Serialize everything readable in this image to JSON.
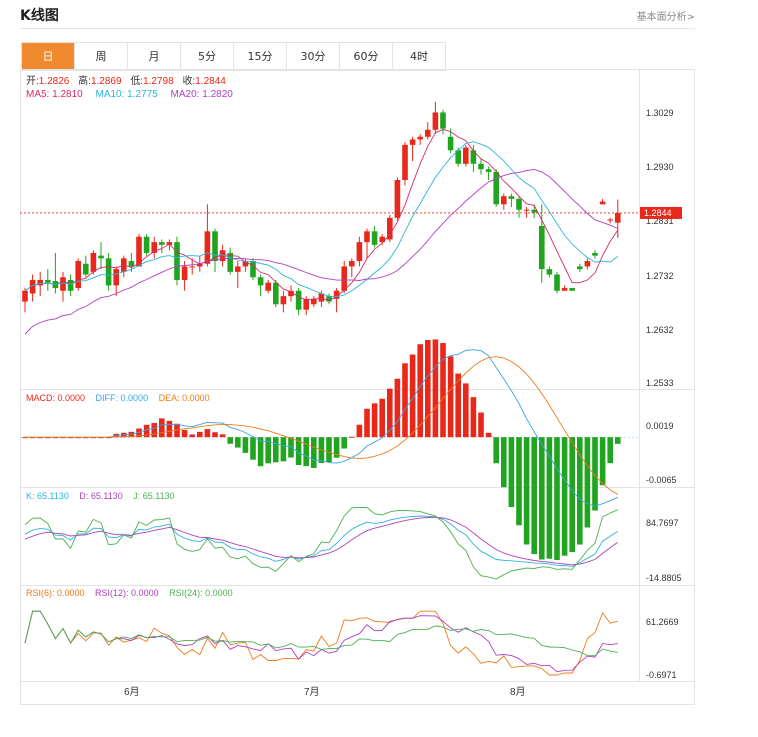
{
  "header": {
    "title": "K线图",
    "link": "基本面分析>"
  },
  "tabs": [
    {
      "label": "日",
      "active": true
    },
    {
      "label": "周",
      "active": false
    },
    {
      "label": "月",
      "active": false
    },
    {
      "label": "5分",
      "active": false
    },
    {
      "label": "15分",
      "active": false
    },
    {
      "label": "30分",
      "active": false
    },
    {
      "label": "60分",
      "active": false
    },
    {
      "label": "4时",
      "active": false
    }
  ],
  "colors": {
    "up": "#e8281a",
    "down": "#1fa51f",
    "ma5": "#d42a6a",
    "ma10": "#2bb5d6",
    "ma20": "#b040c0",
    "diff": "#3ba3e3",
    "dea": "#f07a1a",
    "k": "#2bb5d6",
    "d": "#b040c0",
    "j": "#4caf50",
    "rsi6": "#f07a1a",
    "rsi12": "#b040c0",
    "rsi24": "#4caf50"
  },
  "chart_data": {
    "type": "candlestick",
    "ohlc_info": {
      "open_label": "开:",
      "open": "1.2826",
      "high_label": "高:",
      "high": "1.2869",
      "low_label": "低:",
      "low": "1.2798",
      "close_label": "收:",
      "close": "1.2844"
    },
    "ma_info": {
      "ma5": "MA5: 1.2810",
      "ma10": "MA10: 1.2775",
      "ma20": "MA20: 1.2820"
    },
    "current_price": "1.2844",
    "y_axis": {
      "min": 1.2533,
      "max": 1.308,
      "ticks": [
        "1.3029",
        "1.2930",
        "1.2831",
        "1.2732",
        "1.2632",
        "1.2533"
      ]
    },
    "x_labels": [
      "6月",
      "7月",
      "8月"
    ],
    "candles": [
      [
        1.268,
        1.27,
        1.266,
        1.2705
      ],
      [
        1.2695,
        1.272,
        1.268,
        1.273
      ],
      [
        1.271,
        1.272,
        1.269,
        1.2735
      ],
      [
        1.272,
        1.2715,
        1.27,
        1.274
      ],
      [
        1.2718,
        1.2705,
        1.2695,
        1.277
      ],
      [
        1.27,
        1.2725,
        1.268,
        1.2735
      ],
      [
        1.272,
        1.27,
        1.269,
        1.273
      ],
      [
        1.2705,
        1.2755,
        1.27,
        1.276
      ],
      [
        1.275,
        1.273,
        1.2725,
        1.2765
      ],
      [
        1.2735,
        1.277,
        1.273,
        1.2775
      ],
      [
        1.2765,
        1.276,
        1.274,
        1.279
      ],
      [
        1.276,
        1.271,
        1.27,
        1.277
      ],
      [
        1.271,
        1.274,
        1.269,
        1.2745
      ],
      [
        1.2735,
        1.276,
        1.2725,
        1.2765
      ],
      [
        1.2755,
        1.2745,
        1.2735,
        1.277
      ],
      [
        1.2745,
        1.28,
        1.2745,
        1.2805
      ],
      [
        1.28,
        1.277,
        1.2765,
        1.2805
      ],
      [
        1.277,
        1.279,
        1.276,
        1.28
      ],
      [
        1.279,
        1.2785,
        1.277,
        1.2795
      ],
      [
        1.2785,
        1.279,
        1.2775,
        1.2795
      ],
      [
        1.279,
        1.272,
        1.271,
        1.28
      ],
      [
        1.272,
        1.2745,
        1.27,
        1.2755
      ],
      [
        1.2745,
        1.2745,
        1.273,
        1.276
      ],
      [
        1.2745,
        1.275,
        1.2735,
        1.2765
      ],
      [
        1.275,
        1.281,
        1.2745,
        1.286
      ],
      [
        1.281,
        1.2755,
        1.2735,
        1.2815
      ],
      [
        1.2755,
        1.2775,
        1.2745,
        1.2785
      ],
      [
        1.277,
        1.2735,
        1.273,
        1.278
      ],
      [
        1.2735,
        1.2745,
        1.2705,
        1.2755
      ],
      [
        1.2745,
        1.2755,
        1.2735,
        1.276
      ],
      [
        1.2755,
        1.2725,
        1.272,
        1.276
      ],
      [
        1.2725,
        1.271,
        1.269,
        1.273
      ],
      [
        1.27,
        1.2715,
        1.2695,
        1.272
      ],
      [
        1.2715,
        1.2675,
        1.267,
        1.272
      ],
      [
        1.2675,
        1.269,
        1.266,
        1.27
      ],
      [
        1.269,
        1.27,
        1.268,
        1.271
      ],
      [
        1.27,
        1.2665,
        1.2655,
        1.2705
      ],
      [
        1.2665,
        1.2685,
        1.2655,
        1.269
      ],
      [
        1.2675,
        1.2685,
        1.267,
        1.269
      ],
      [
        1.268,
        1.2695,
        1.267,
        1.27
      ],
      [
        1.269,
        1.268,
        1.2675,
        1.2695
      ],
      [
        1.2685,
        1.27,
        1.266,
        1.2705
      ],
      [
        1.27,
        1.2745,
        1.2695,
        1.2755
      ],
      [
        1.2745,
        1.2755,
        1.2725,
        1.276
      ],
      [
        1.2755,
        1.279,
        1.2745,
        1.28
      ],
      [
        1.279,
        1.281,
        1.276,
        1.2815
      ],
      [
        1.281,
        1.2785,
        1.278,
        1.282
      ],
      [
        1.279,
        1.28,
        1.2785,
        1.2805
      ],
      [
        1.2795,
        1.2835,
        1.279,
        1.284
      ],
      [
        1.2835,
        1.2905,
        1.283,
        1.291
      ],
      [
        1.2905,
        1.297,
        1.2895,
        1.2975
      ],
      [
        1.297,
        1.298,
        1.294,
        1.2985
      ],
      [
        1.298,
        1.2985,
        1.297,
        1.299
      ],
      [
        1.2985,
        1.2998,
        1.298,
        1.3012
      ],
      [
        1.2998,
        1.303,
        1.299,
        1.305
      ],
      [
        1.303,
        1.3,
        1.299,
        1.3035
      ],
      [
        1.2985,
        1.296,
        1.2955,
        1.3
      ],
      [
        1.296,
        1.2935,
        1.293,
        1.2965
      ],
      [
        1.2935,
        1.2965,
        1.293,
        1.297
      ],
      [
        1.296,
        1.2935,
        1.292,
        1.297
      ],
      [
        1.2935,
        1.2925,
        1.2915,
        1.2945
      ],
      [
        1.2925,
        1.292,
        1.2905,
        1.293
      ],
      [
        1.292,
        1.286,
        1.2855,
        1.2925
      ],
      [
        1.286,
        1.2875,
        1.285,
        1.288
      ],
      [
        1.2875,
        1.287,
        1.2855,
        1.288
      ],
      [
        1.287,
        1.285,
        1.2835,
        1.2875
      ],
      [
        1.285,
        1.285,
        1.2835,
        1.2855
      ],
      [
        1.285,
        1.2845,
        1.2835,
        1.286
      ],
      [
        1.282,
        1.274,
        1.2715,
        1.286
      ],
      [
        1.274,
        1.273,
        1.2725,
        1.2745
      ],
      [
        1.273,
        1.27,
        1.2695,
        1.2735
      ],
      [
        1.27,
        1.2705,
        1.27,
        1.271
      ],
      [
        1.2705,
        1.27,
        1.27,
        1.2705
      ],
      [
        1.2745,
        1.274,
        1.2735,
        1.275
      ],
      [
        1.2745,
        1.2755,
        1.274,
        1.276
      ],
      [
        1.277,
        1.2765,
        1.276,
        1.2775
      ],
      [
        1.286,
        1.2865,
        1.286,
        1.287
      ],
      [
        1.283,
        1.2832,
        1.2825,
        1.2835
      ],
      [
        1.2826,
        1.2844,
        1.2798,
        1.2869
      ]
    ],
    "macd": {
      "info": {
        "macd": "MACD: 0.0000",
        "diff": "DIFF: 0.0000",
        "dea": "DEA: 0.0000"
      },
      "y_ticks": [
        "0.0019",
        "-0.0065"
      ],
      "min": -0.0065,
      "max": 0.004
    },
    "kdj": {
      "info": {
        "k": "K: 65.1130",
        "d": "D: 65.1130",
        "j": "J: 65.1130"
      },
      "y_ticks": [
        "84.7697",
        "-14.8805"
      ],
      "min": -14.8805,
      "max": 84.7697
    },
    "rsi": {
      "info": {
        "rsi6": "RSI(6): 0.0000",
        "rsi12": "RSI(12): 0.0000",
        "rsi24": "RSI(24): 0.0000"
      },
      "y_ticks": [
        "61.2669",
        "-0.6971"
      ],
      "min": -0.6971,
      "max": 61.2669
    }
  }
}
